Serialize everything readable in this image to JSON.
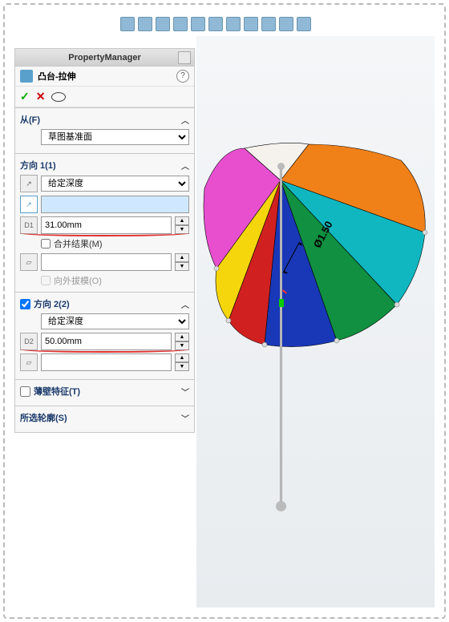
{
  "pm_title": "PropertyManager",
  "feature": {
    "name": "凸台-拉伸",
    "help": "?"
  },
  "from": {
    "label": "从(F)",
    "option": "草图基准面"
  },
  "dir1": {
    "label": "方向 1(1)",
    "type": "给定深度",
    "depth": "31.00mm",
    "merge": "合并结果(M)",
    "draft": "向外拔模(O)"
  },
  "dir2": {
    "label": "方向 2(2)",
    "type": "给定深度",
    "depth": "50.00mm"
  },
  "thin": {
    "label": "薄壁特征(T)"
  },
  "contour": {
    "label": "所选轮廓(S)"
  },
  "dimension": "Ø1.50"
}
